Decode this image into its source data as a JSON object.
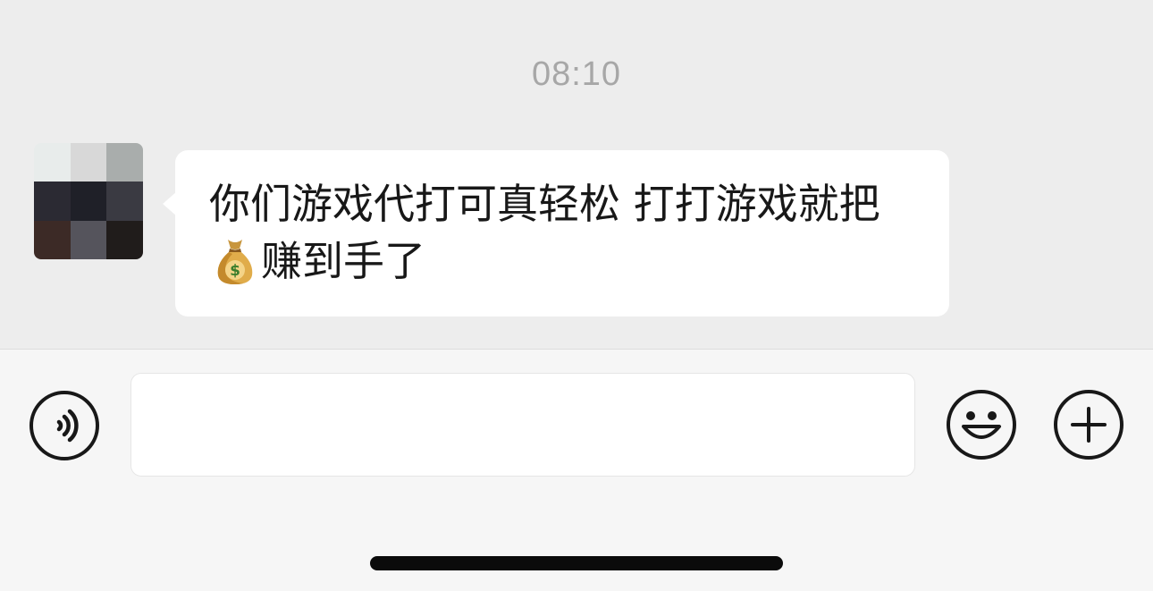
{
  "chat": {
    "timestamp": "08:10",
    "message": {
      "text_before_emoji": "你们游戏代打可真轻松 打打游戏就把",
      "emoji": "money-bag",
      "text_after_emoji": "赚到手了"
    },
    "avatar": {
      "colors": [
        "#e8eceb",
        "#d8d8d8",
        "#a9adac",
        "#2b2a33",
        "#1f2028",
        "#3a3a42",
        "#3c2a26",
        "#55545c",
        "#201c1b"
      ]
    }
  },
  "input_bar": {
    "placeholder": "",
    "value": ""
  },
  "icons": {
    "voice": "voice-icon",
    "emoji": "emoji-icon",
    "plus": "plus-icon"
  }
}
